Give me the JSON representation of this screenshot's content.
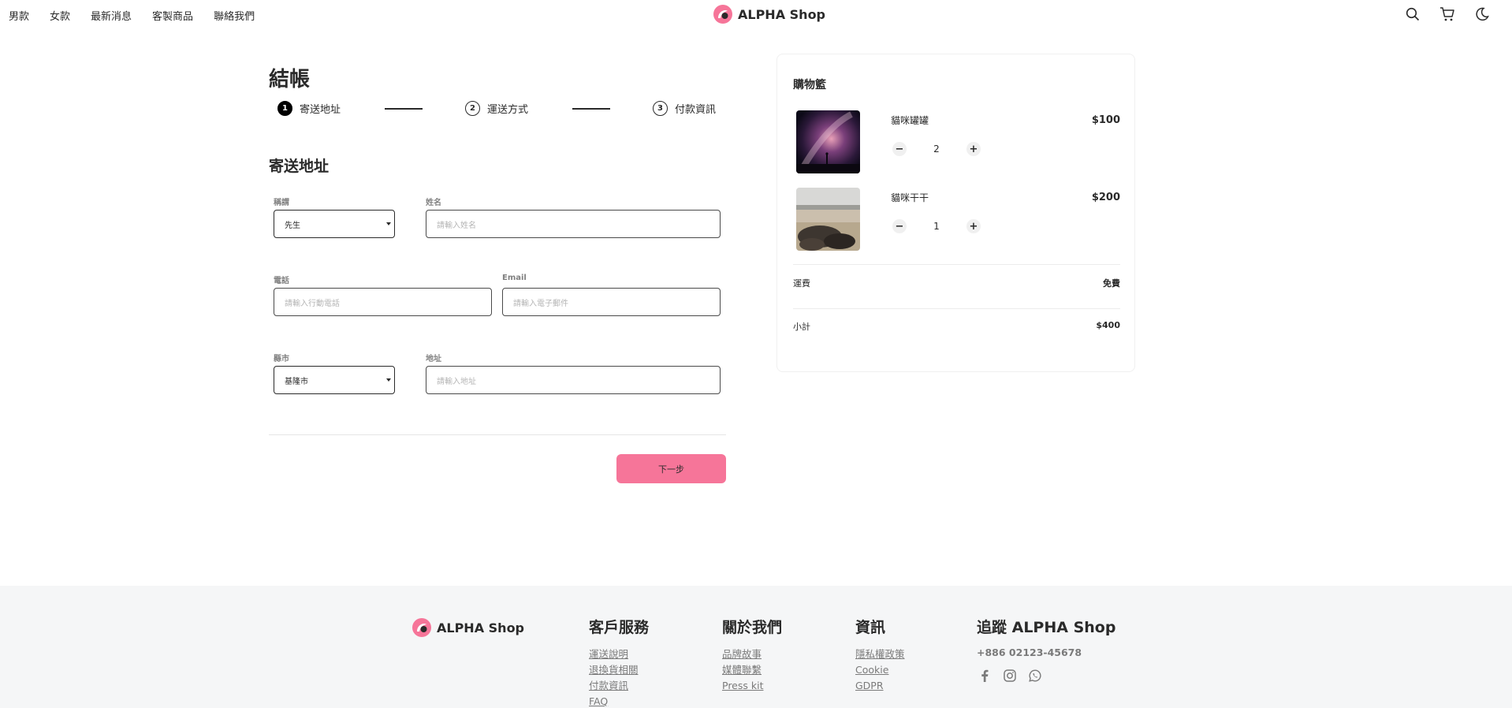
{
  "header": {
    "nav": [
      "男款",
      "女款",
      "最新消息",
      "客製商品",
      "聯絡我們"
    ],
    "brand": "ALPHA Shop",
    "icons": [
      "search-icon",
      "cart-icon",
      "moon-icon"
    ]
  },
  "checkout": {
    "title": "結帳",
    "steps": [
      {
        "num": "1",
        "label": "寄送地址",
        "active": true
      },
      {
        "num": "2",
        "label": "運送方式",
        "active": false
      },
      {
        "num": "3",
        "label": "付款資訊",
        "active": false
      }
    ],
    "section_title": "寄送地址",
    "fields": {
      "salutation": {
        "label": "稱謂",
        "value": "先生"
      },
      "name": {
        "label": "姓名",
        "placeholder": "請輸入姓名"
      },
      "phone": {
        "label": "電話",
        "placeholder": "請輸入行動電話"
      },
      "email": {
        "label": "Email",
        "placeholder": "請輸入電子郵件"
      },
      "city": {
        "label": "縣市",
        "value": "基隆市"
      },
      "address": {
        "label": "地址",
        "placeholder": "請輸入地址"
      }
    },
    "next_button": "下一步"
  },
  "cart": {
    "title": "購物籃",
    "items": [
      {
        "name": "貓咪罐罐",
        "price": "$100",
        "qty": "2"
      },
      {
        "name": "貓咪干干",
        "price": "$200",
        "qty": "1"
      }
    ],
    "shipping_label": "運費",
    "shipping_value": "免費",
    "subtotal_label": "小計",
    "subtotal_value": "$400"
  },
  "footer": {
    "brand": "ALPHA Shop",
    "columns": [
      {
        "heading": "客戶服務",
        "links": [
          "運送說明",
          "退換貨相關",
          "付款資訊",
          "FAQ"
        ]
      },
      {
        "heading": "關於我們",
        "links": [
          "品牌故事",
          "媒體聯繫",
          "Press kit"
        ]
      },
      {
        "heading": "資訊",
        "links": [
          "隱私權政策",
          "Cookie",
          "GDPR"
        ]
      }
    ],
    "follow_heading": "追蹤 ALPHA Shop",
    "phone": "+886 02123-45678",
    "social_icons": [
      "facebook-icon",
      "instagram-icon",
      "whatsapp-icon"
    ]
  },
  "colors": {
    "accent": "#f67599",
    "footer_bg": "#f5f6f7",
    "text": "#2a2a2a"
  }
}
